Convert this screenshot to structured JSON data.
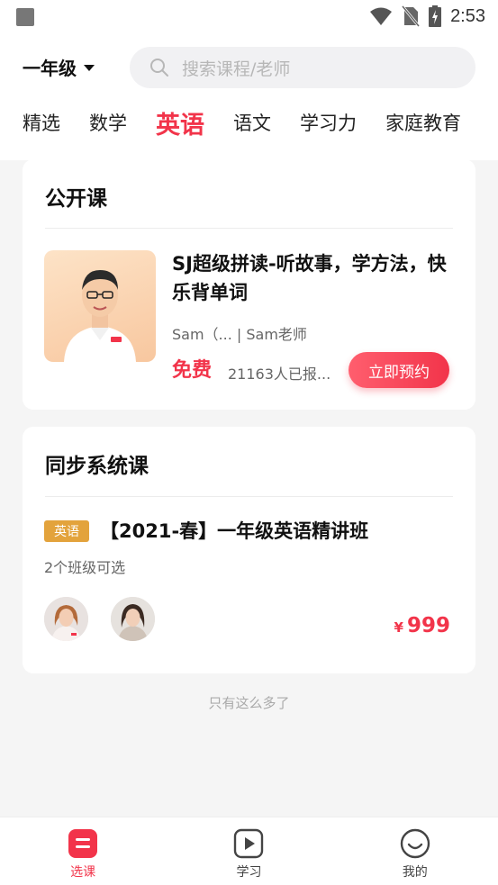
{
  "status_bar": {
    "time": "2:53"
  },
  "header": {
    "grade": "一年级",
    "search_placeholder": "搜索课程/老师"
  },
  "tabs": [
    {
      "label": "精选"
    },
    {
      "label": "数学"
    },
    {
      "label": "英语",
      "active": true
    },
    {
      "label": "语文"
    },
    {
      "label": "学习力"
    },
    {
      "label": "家庭教育"
    }
  ],
  "open_class": {
    "title": "公开课",
    "course_title": "SJ超级拼读-听故事，学方法，快乐背单词",
    "teacher": "Sam（... | Sam老师",
    "price_label": "免费",
    "enrolled": "21163人已报...",
    "reserve_button": "立即预约"
  },
  "sync_course": {
    "title": "同步系统课",
    "tag": "英语",
    "course_title": "【2021-春】一年级英语精讲班",
    "subtitle": "2个班级可选",
    "price_currency": "¥",
    "price": "999"
  },
  "footer_note": "只有这么多了",
  "bottom_nav": [
    {
      "label": "选课",
      "icon": "course-select-icon",
      "active": true
    },
    {
      "label": "学习",
      "icon": "play-icon"
    },
    {
      "label": "我的",
      "icon": "smile-icon"
    }
  ],
  "colors": {
    "accent": "#f2344a",
    "tag": "#e3a33c",
    "background": "#f5f5f5"
  }
}
